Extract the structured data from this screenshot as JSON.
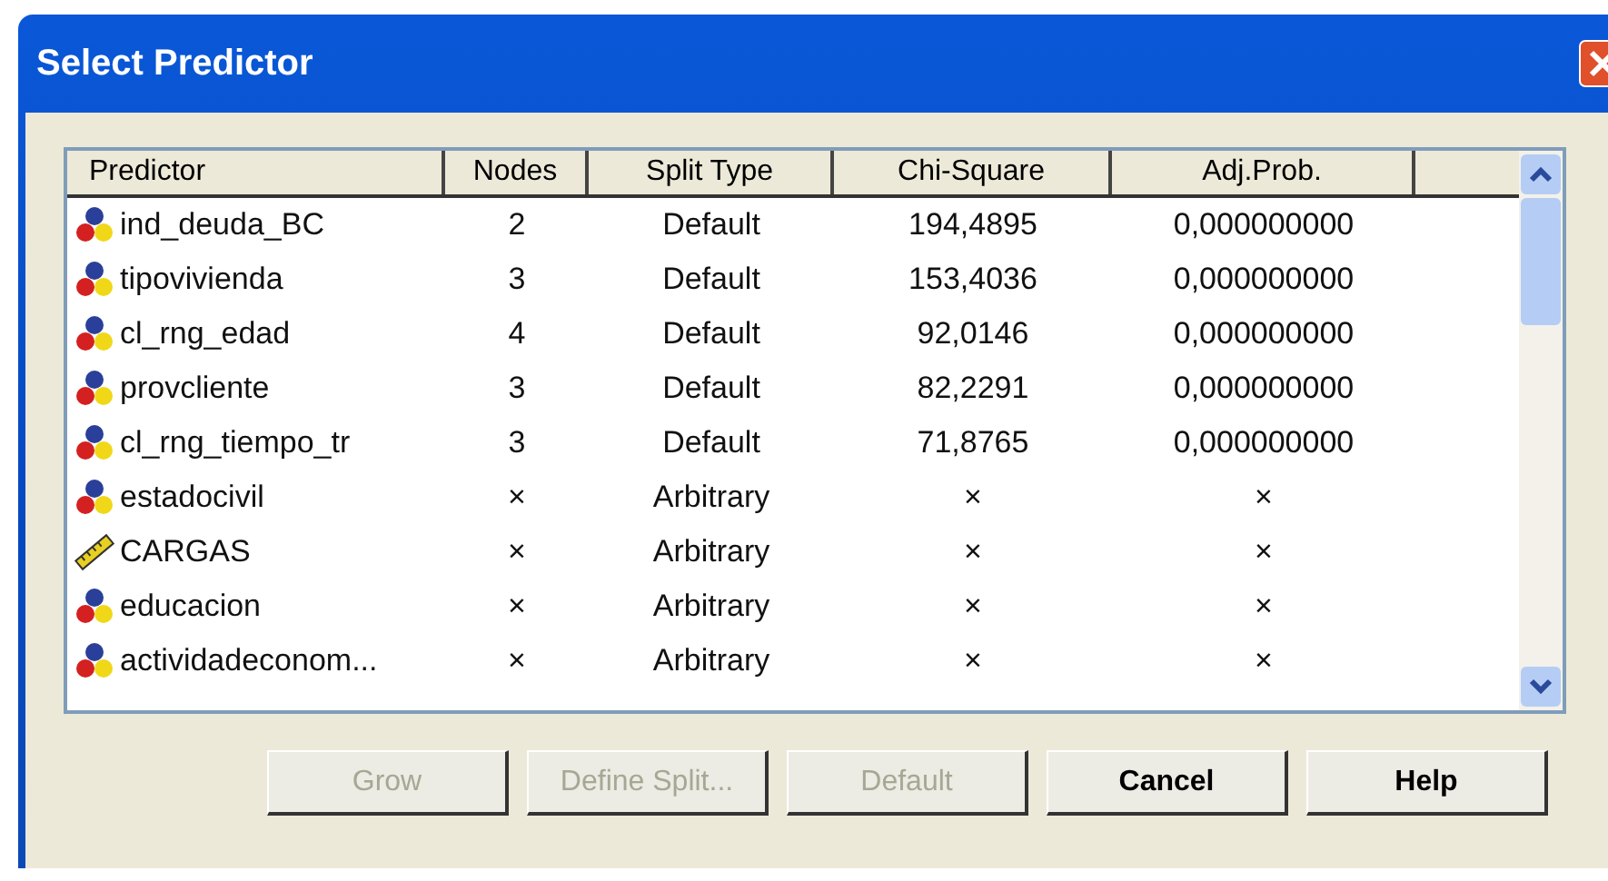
{
  "window": {
    "title": "Select Predictor"
  },
  "table": {
    "columns": [
      "Predictor",
      "Nodes",
      "Split Type",
      "Chi-Square",
      "Adj.Prob."
    ],
    "rows": [
      {
        "kind": "nominal",
        "cells": [
          "ind_deuda_BC",
          "2",
          "Default",
          "194,4895",
          "0,000000000"
        ]
      },
      {
        "kind": "nominal",
        "cells": [
          "tipovivienda",
          "3",
          "Default",
          "153,4036",
          "0,000000000"
        ]
      },
      {
        "kind": "nominal",
        "cells": [
          "cl_rng_edad",
          "4",
          "Default",
          "92,0146",
          "0,000000000"
        ]
      },
      {
        "kind": "nominal",
        "cells": [
          "provcliente",
          "3",
          "Default",
          "82,2291",
          "0,000000000"
        ]
      },
      {
        "kind": "nominal",
        "cells": [
          "cl_rng_tiempo_tr",
          "3",
          "Default",
          "71,8765",
          "0,000000000"
        ]
      },
      {
        "kind": "nominal",
        "cells": [
          "estadocivil",
          "×",
          "Arbitrary",
          "×",
          "×"
        ]
      },
      {
        "kind": "scale",
        "cells": [
          "CARGAS",
          "×",
          "Arbitrary",
          "×",
          "×"
        ]
      },
      {
        "kind": "nominal",
        "cells": [
          "educacion",
          "×",
          "Arbitrary",
          "×",
          "×"
        ]
      },
      {
        "kind": "nominal",
        "cells": [
          "actividadeconom...",
          "×",
          "Arbitrary",
          "×",
          "×"
        ]
      }
    ]
  },
  "buttons": [
    {
      "label": "Grow",
      "disabled": true
    },
    {
      "label": "Define Split...",
      "disabled": true
    },
    {
      "label": "Default",
      "disabled": true
    },
    {
      "label": "Cancel",
      "disabled": false
    },
    {
      "label": "Help",
      "disabled": false
    }
  ]
}
